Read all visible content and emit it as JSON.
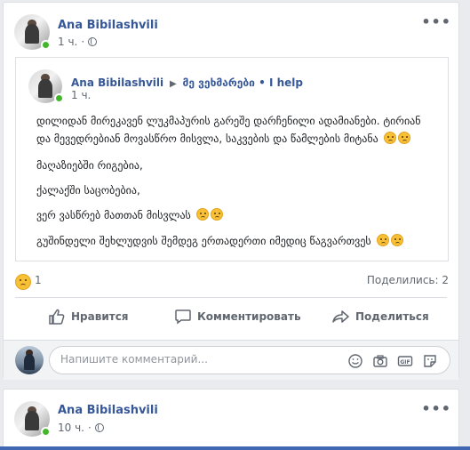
{
  "post1": {
    "author": "Ana Bibilashvili",
    "time": "1 ч.",
    "separator": "·",
    "shared": {
      "author": "Ana Bibilashvili",
      "arrow": "▶",
      "group": "მე ვეხმარები • I help",
      "time": "1 ч.",
      "lines": [
        "დილიდან მირეკავენ ლუკმაპურის გარეშე დარჩენილი ადამიანები. ტირიან",
        "და მევედრებიან მოვასწრო მისვლა, საკვების და წამლების მიტანა",
        "მაღაზიებში რიგებია,",
        "ქალაქში საცობებია,",
        "ვერ ვასწრებ მათთან მისვლას",
        "გუშინდელი შეხლუდვის შემდეგ ერთადერთი იმედიც წაგვართვეს"
      ]
    },
    "reactions_count": "1",
    "shares": "Поделились: 2",
    "actions": {
      "like": "Нравится",
      "comment": "Комментировать",
      "share": "Поделиться"
    },
    "comment_placeholder": "Напишите комментарий..."
  },
  "post2": {
    "author": "Ana Bibilashvili",
    "time": "10 ч.",
    "separator": "·"
  },
  "icons": {
    "more": "more-options-icon",
    "globe": "globe-icon",
    "like": "thumbs-up-icon",
    "comment": "comment-bubble-icon",
    "share": "share-arrow-icon",
    "emoji": "emoji-icon",
    "camera": "camera-icon",
    "gif": "gif-icon",
    "sticker": "sticker-icon",
    "sad": "sad-emoji-icon"
  },
  "colors": {
    "name": "#365899",
    "online": "#42b72a",
    "meta": "#606770",
    "bg": "#e9ebee"
  }
}
